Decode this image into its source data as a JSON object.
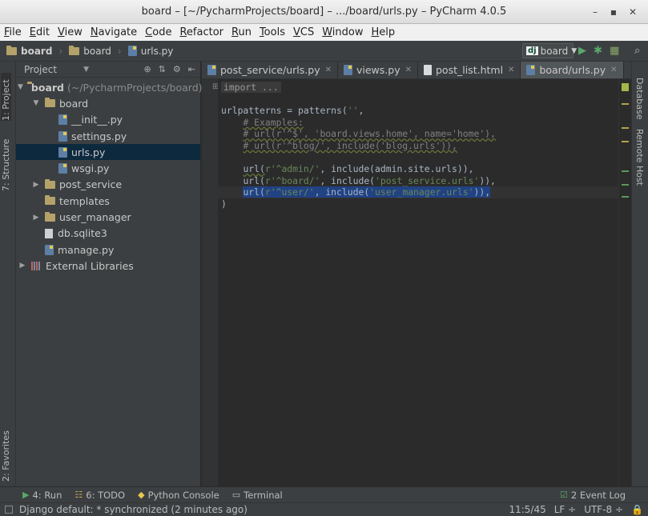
{
  "window": {
    "title": "board – [~/PycharmProjects/board] – .../board/urls.py – PyCharm 4.0.5"
  },
  "menu": [
    "File",
    "Edit",
    "View",
    "Navigate",
    "Code",
    "Refactor",
    "Run",
    "Tools",
    "VCS",
    "Window",
    "Help"
  ],
  "breadcrumbs": [
    "board",
    "board",
    "urls.py"
  ],
  "run_config": {
    "dj": "dj",
    "name": "board"
  },
  "left_tabs": {
    "project": "1: Project",
    "structure": "7: Structure",
    "favorites": "2: Favorites"
  },
  "right_tabs": {
    "database": "Database",
    "remote_host": "Remote Host"
  },
  "project_panel": {
    "header": "Project",
    "tree": {
      "root_name": "board",
      "root_path": "(~/PycharmProjects/board)",
      "board_pkg": "board",
      "init": "__init__.py",
      "settings": "settings.py",
      "urls": "urls.py",
      "wsgi": "wsgi.py",
      "post_service": "post_service",
      "templates": "templates",
      "user_manager": "user_manager",
      "db": "db.sqlite3",
      "manage": "manage.py",
      "ext_libs": "External Libraries"
    }
  },
  "editor_tabs": [
    "post_service/urls.py",
    "views.py",
    "post_list.html",
    "board/urls.py"
  ],
  "code": {
    "import_fold": "import ...",
    "l1a": "urlpatterns = patterns(",
    "l1b": "''",
    "l1c": ",",
    "c1": "# Examples:",
    "c2": "# url(r'^$', 'board.views.home', name='home'),",
    "c3": "# url(r'^blog/', include('blog.urls')),",
    "a1": "url(",
    "a2": "r'^admin/'",
    "a3": ", include(admin.site.urls)),",
    "b1": "url(",
    "b2": "r'^board/'",
    "b3": ", include(",
    "b4": "'post_service.urls'",
    "b5": ")),",
    "u1": "url(",
    "u2": "r'^user/'",
    "u3": ", include(",
    "u4": "'user_manager.urls'",
    "u5": ")),",
    "close": ")"
  },
  "bottom_tools": {
    "run": "4: Run",
    "todo": "6: TODO",
    "console": "Python Console",
    "terminal": "Terminal",
    "event_log": "2 Event Log"
  },
  "status": {
    "message": "Django default: * synchronized (2 minutes ago)",
    "position": "11:5/45",
    "line_sep": "LF ÷",
    "encoding": "UTF-8 ÷"
  }
}
